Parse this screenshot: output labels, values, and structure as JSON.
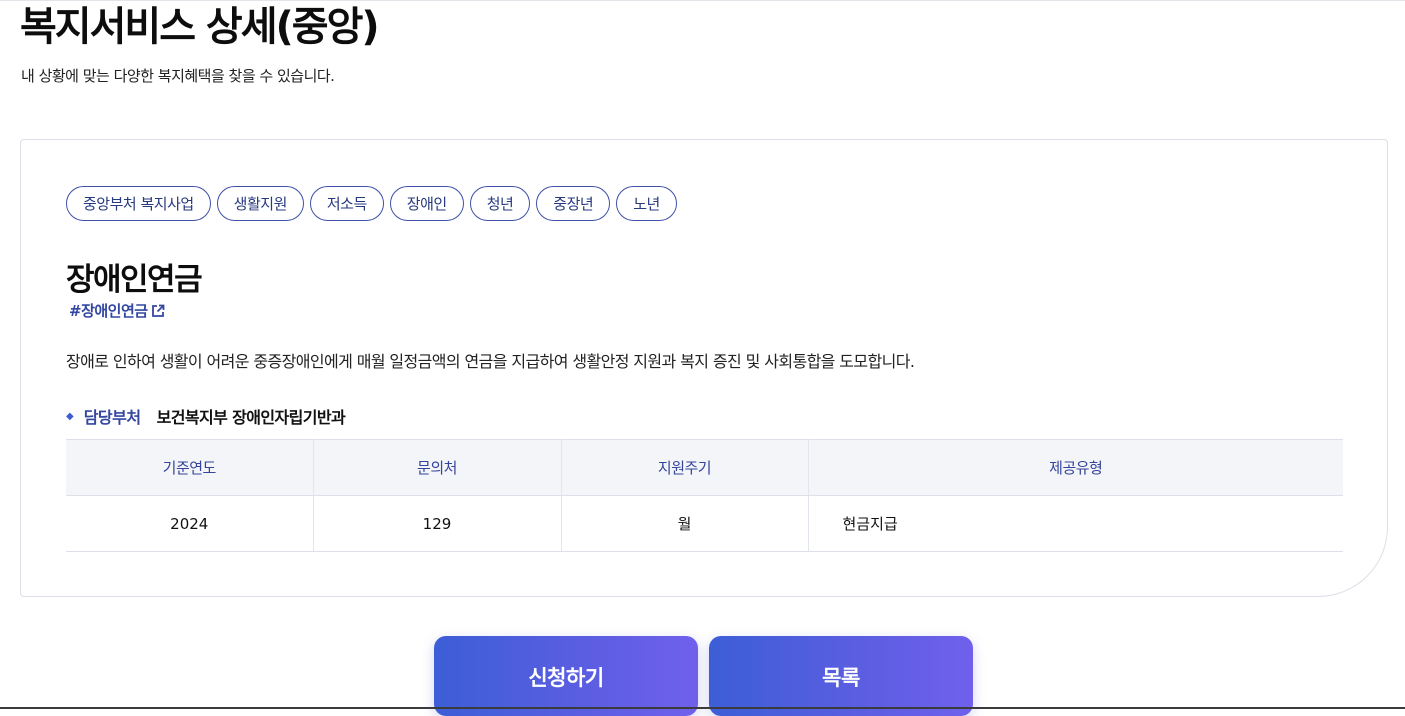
{
  "header": {
    "title": "복지서비스 상세(중앙)",
    "subtitle": "내 상황에 맞는 다양한 복지혜택을 찾을 수 있습니다."
  },
  "service": {
    "tags": [
      "중앙부처 복지사업",
      "생활지원",
      "저소득",
      "장애인",
      "청년",
      "중장년",
      "노년"
    ],
    "name": "장애인연금",
    "hashtag": "#장애인연금",
    "description": "장애로 인하여 생활이 어려운 중증장애인에게 매월 일정금액의 연금을 지급하여 생활안정 지원과 복지 증진 및 사회통합을 도모합니다.",
    "department_label": "담당부처",
    "department": "보건복지부 장애인자립기반과",
    "table": {
      "headers": [
        "기준연도",
        "문의처",
        "지원주기",
        "제공유형"
      ],
      "row": [
        "2024",
        "129",
        "월",
        "현금지급"
      ]
    }
  },
  "actions": {
    "apply_label": "신청하기",
    "list_label": "목록"
  },
  "colors": {
    "accent": "#3347a1",
    "tag_border": "#3f51a8",
    "button_gradient_start": "#3c5ed6",
    "button_gradient_end": "#7060ec",
    "table_header_bg": "#f4f5f9"
  },
  "icons": {
    "hashtag_link": "external-link-icon",
    "department_bullet": "diamond-bullet-icon"
  }
}
